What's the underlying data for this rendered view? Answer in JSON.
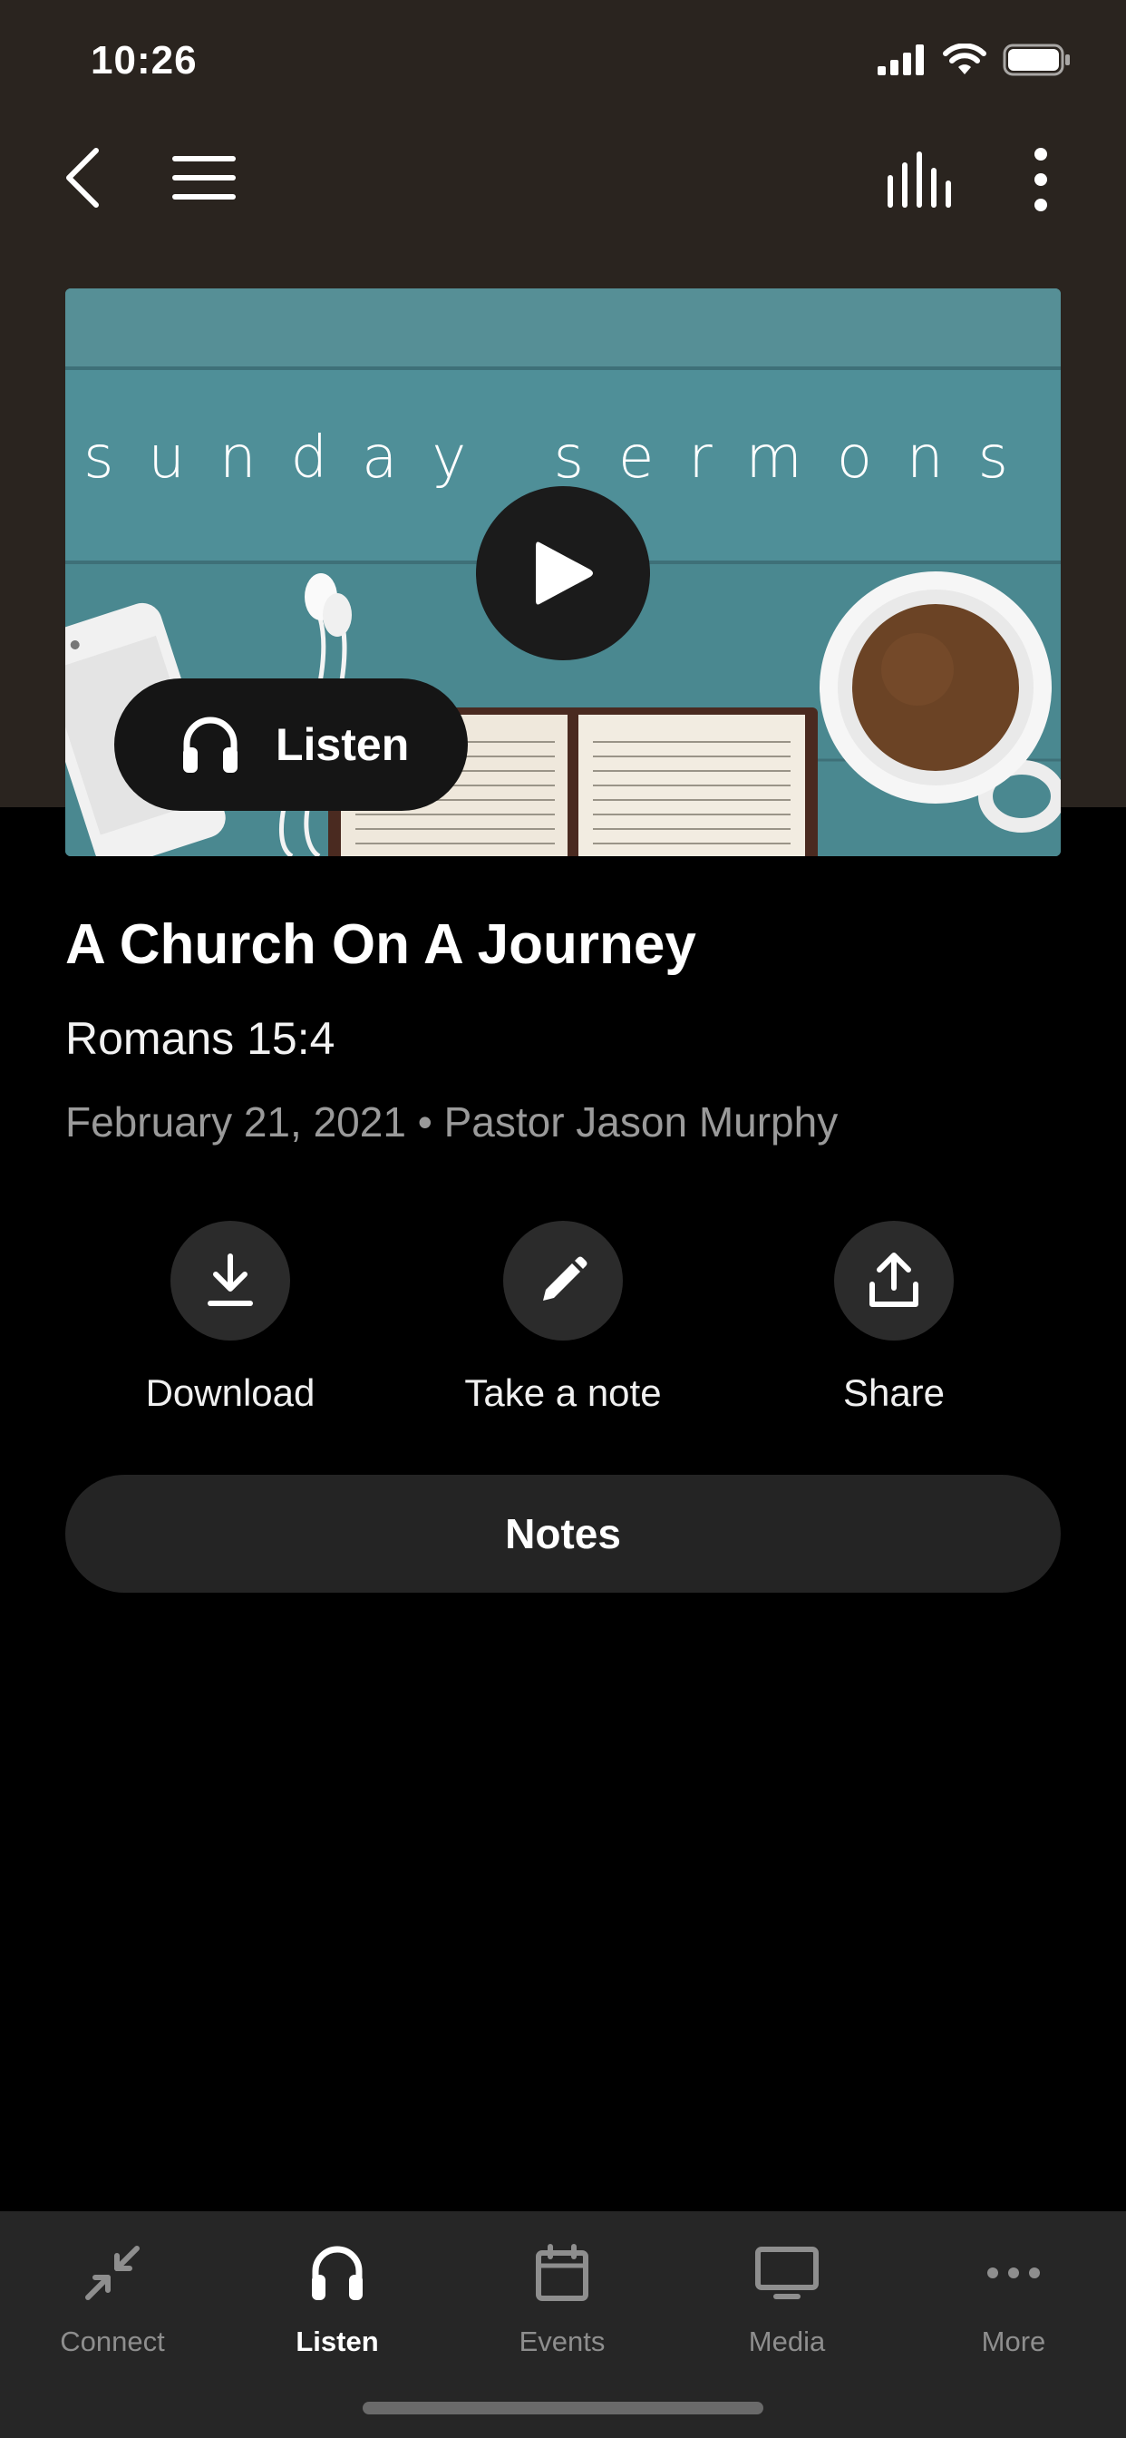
{
  "status_bar": {
    "time": "10:26"
  },
  "artwork": {
    "caption": "sunday sermons"
  },
  "player": {
    "listen_label": "Listen"
  },
  "sermon": {
    "title": "A Church On A Journey",
    "scripture": "Romans 15:4",
    "date": "February 21, 2021",
    "separator": "•",
    "speaker": "Pastor Jason Murphy"
  },
  "actions": {
    "download": "Download",
    "take_note": "Take a note",
    "share": "Share"
  },
  "notes_button": "Notes",
  "tabs": [
    {
      "label": "Connect",
      "icon": "connect-icon",
      "active": false
    },
    {
      "label": "Listen",
      "icon": "headphones-icon",
      "active": true
    },
    {
      "label": "Events",
      "icon": "calendar-icon",
      "active": false
    },
    {
      "label": "Media",
      "icon": "monitor-icon",
      "active": false
    },
    {
      "label": "More",
      "icon": "more-dots-icon",
      "active": false
    }
  ],
  "colors": {
    "header_bg": "#2a241f",
    "background": "#000000",
    "button_bg": "#242424",
    "tabbar_bg": "#262626",
    "muted_text": "#9a9a9a",
    "artwork_teal": "#4f8f98"
  }
}
